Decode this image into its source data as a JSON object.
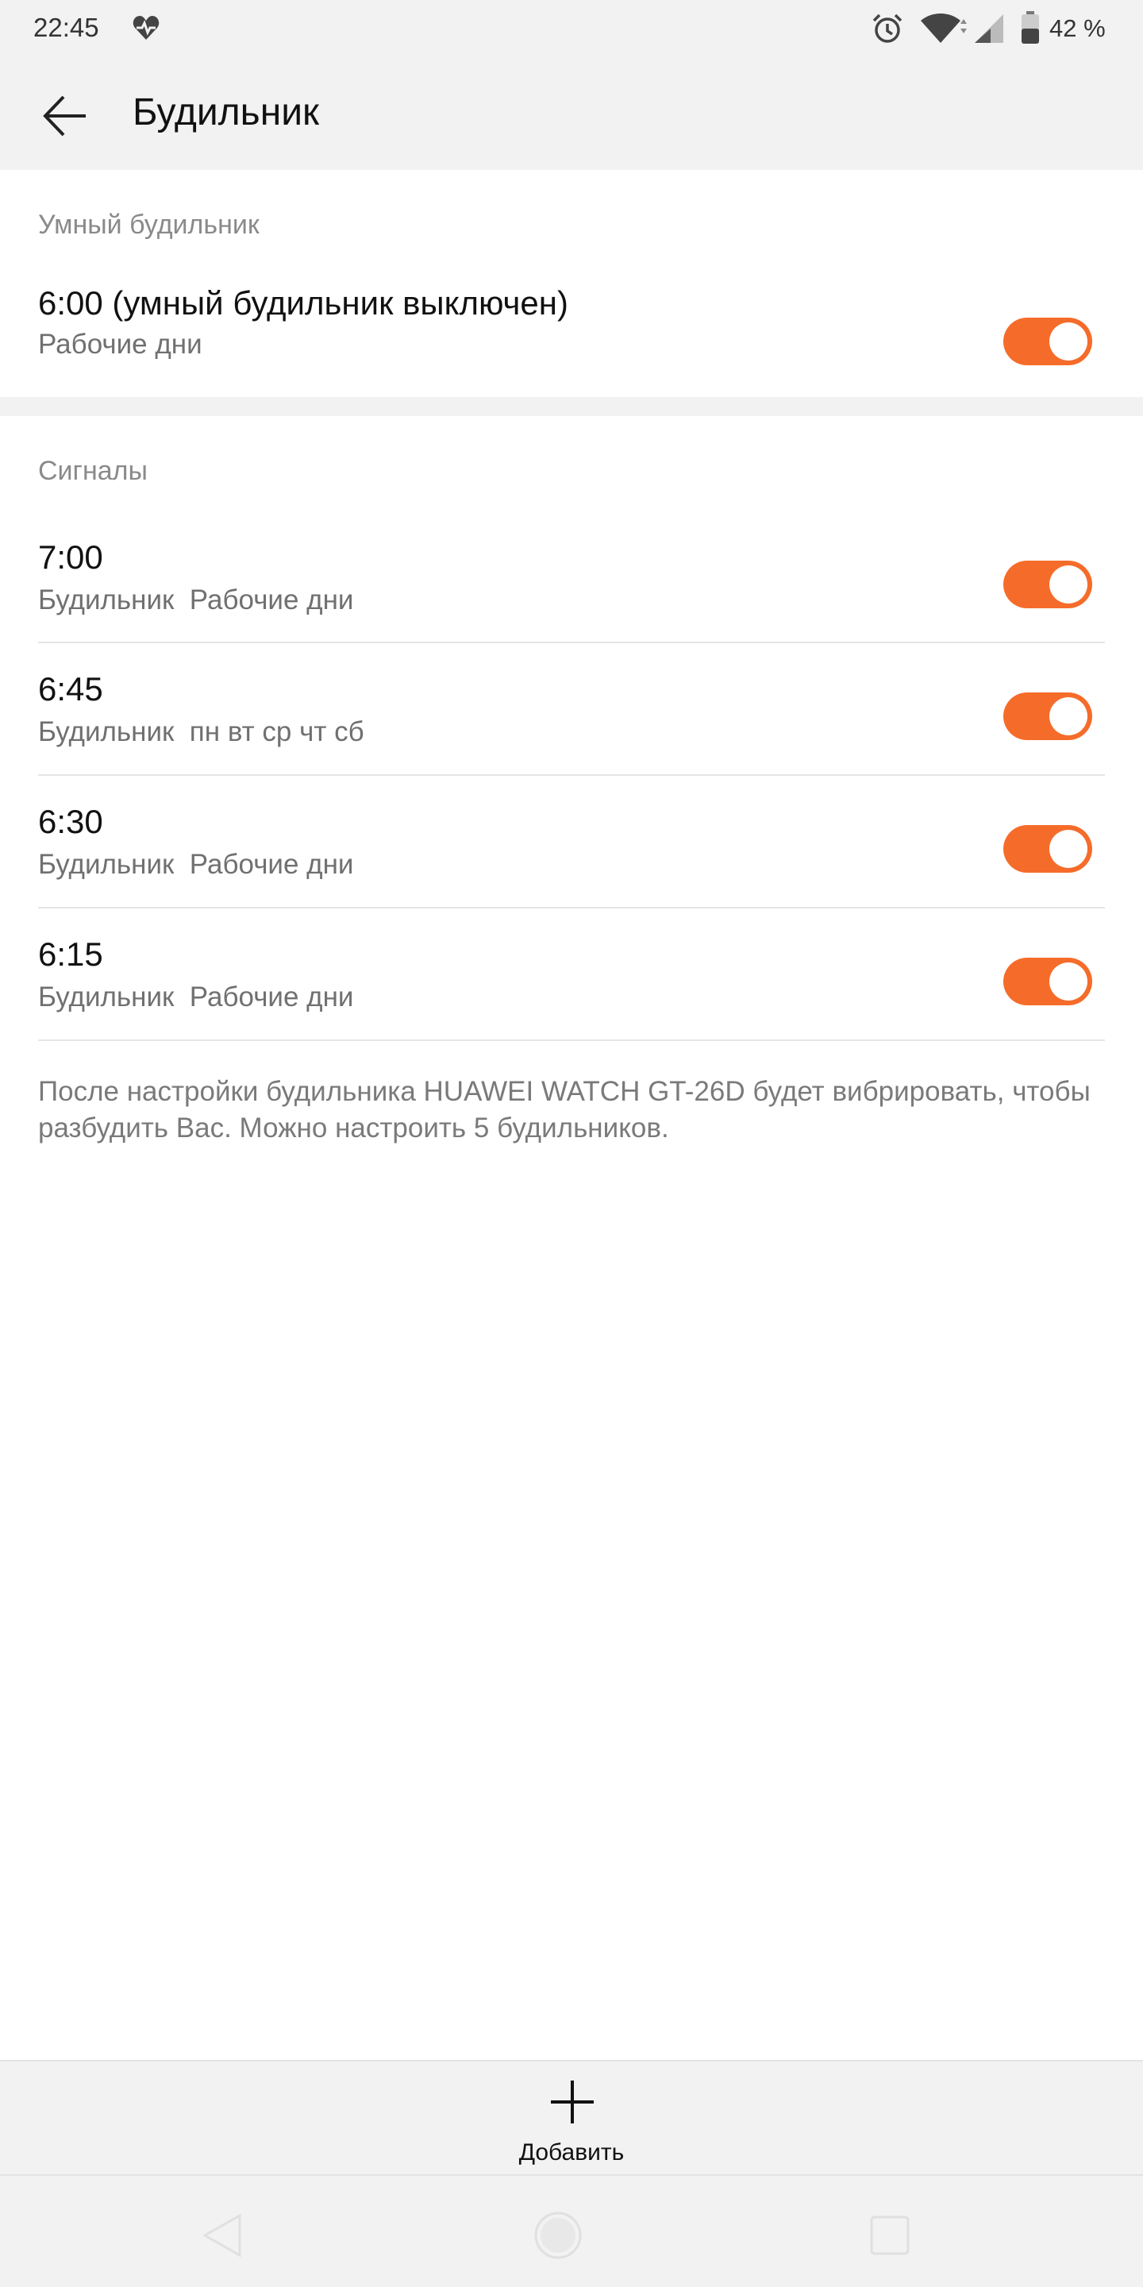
{
  "status_bar": {
    "time": "22:45",
    "battery_text": "42 %",
    "icons": [
      "heart-rate-icon",
      "alarm-clock-icon",
      "wifi-icon",
      "cellular-signal-icon",
      "battery-icon"
    ]
  },
  "app_bar": {
    "title": "Будильник",
    "back_icon": "arrow-left-icon"
  },
  "smart_alarm": {
    "header": "Умный будильник",
    "time": "6:00 (умный будильник выключен)",
    "subtitle": "Рабочие дни",
    "enabled": true
  },
  "signals": {
    "header": "Сигналы",
    "items": [
      {
        "time": "7:00",
        "subtitle": "Будильник  Рабочие дни",
        "enabled": true
      },
      {
        "time": "6:45",
        "subtitle": "Будильник  пн вт ср чт сб",
        "enabled": true
      },
      {
        "time": "6:30",
        "subtitle": "Будильник  Рабочие дни",
        "enabled": true
      },
      {
        "time": "6:15",
        "subtitle": "Будильник  Рабочие дни",
        "enabled": true
      }
    ]
  },
  "footnote": "После настройки будильника HUAWEI WATCH GT-26D будет вибрировать, чтобы разбудить Вас. Можно настроить 5 будильников.",
  "add_bar": {
    "label": "Добавить",
    "icon": "plus-icon"
  },
  "colors": {
    "accent": "#f56c2a",
    "background": "#f2f2f2",
    "card": "#ffffff",
    "secondary_text": "#8a8a8a"
  }
}
